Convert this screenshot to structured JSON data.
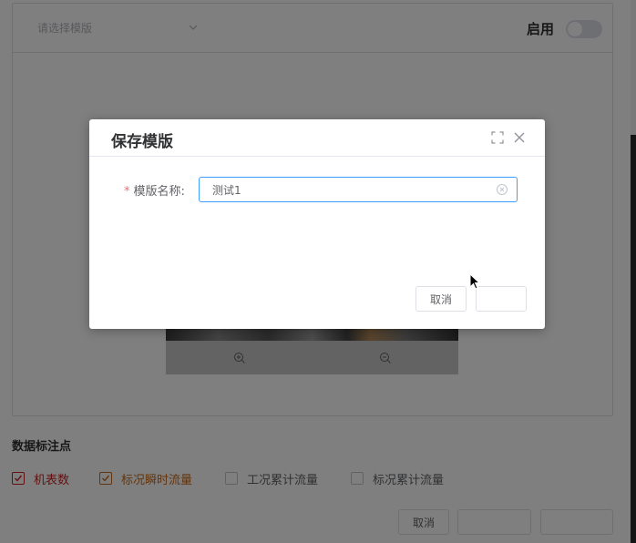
{
  "background": {
    "template_select": {
      "placeholder": "请选择模版"
    },
    "enable_label": "启用",
    "section_title": "数据标注点",
    "checkboxes": [
      {
        "label": "机表数",
        "checked": true,
        "color": "#cc1f1f"
      },
      {
        "label": "标况瞬时流量",
        "checked": true,
        "color": "#c76a1a"
      },
      {
        "label": "工况累计流量",
        "checked": false
      },
      {
        "label": "标况累计流量",
        "checked": false
      }
    ],
    "buttons": {
      "cancel": "取消"
    }
  },
  "dialog": {
    "title": "保存模版",
    "form": {
      "required_mark": "*",
      "label": "模版名称:",
      "value": "测试1"
    },
    "buttons": {
      "cancel": "取消"
    }
  },
  "colors": {
    "accent": "#409eff",
    "overlay": "rgba(0,0,0,0.5)"
  }
}
